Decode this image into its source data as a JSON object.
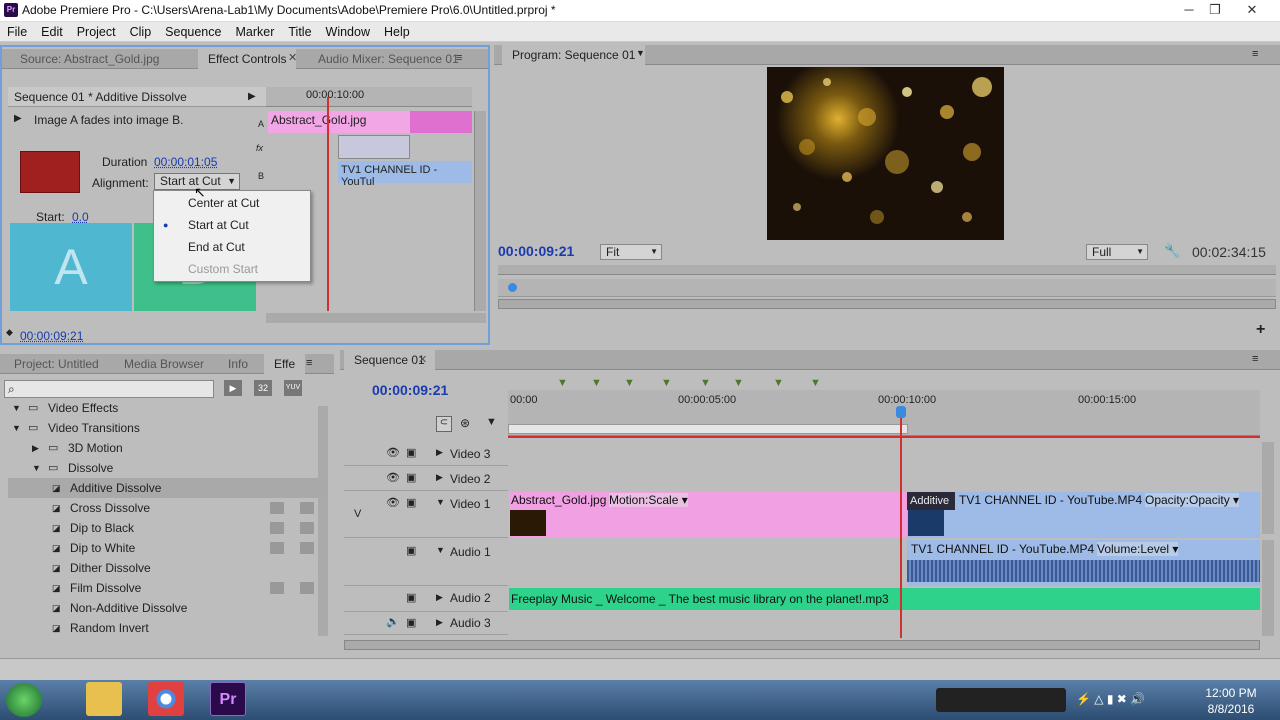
{
  "window": {
    "title": "Adobe Premiere Pro - C:\\Users\\Arena-Lab1\\My Documents\\Adobe\\Premiere Pro\\6.0\\Untitled.prproj *",
    "min": "─",
    "max": "❐",
    "close": "✕"
  },
  "menu": [
    "File",
    "Edit",
    "Project",
    "Clip",
    "Sequence",
    "Marker",
    "Title",
    "Window",
    "Help"
  ],
  "source_panel": {
    "tabs": [
      "Source: Abstract_Gold.jpg",
      "Effect Controls",
      "Audio Mixer: Sequence 01"
    ],
    "header": "Sequence 01 * Additive Dissolve",
    "description": "Image A fades into image B.",
    "duration_label": "Duration",
    "duration_value": "00:00:01:05",
    "alignment_label": "Alignment:",
    "alignment_value": "Start at Cut",
    "start_label": "Start:",
    "start_value": "0.0",
    "preview_a": "A",
    "preview_b": "B",
    "ruler_time": "00:00:10:00",
    "clip_a": "Abstract_Gold.jpg",
    "clip_b": "TV1 CHANNEL ID - YouTul",
    "track_a": "A",
    "track_fx": "fx",
    "track_b": "B",
    "footer_time": "00:00:09:21",
    "dropdown": [
      "Center at Cut",
      "Start at Cut",
      "End at Cut",
      "Custom Start"
    ]
  },
  "program_panel": {
    "title": "Program: Sequence 01",
    "timecode": "00:00:09:21",
    "fit": "Fit",
    "quality": "Full",
    "duration": "00:02:34:15",
    "add": "+"
  },
  "project_panel": {
    "tabs": [
      "Project: Untitled",
      "Media Browser",
      "Info",
      "Effe"
    ],
    "tree": [
      {
        "label": "Video Effects",
        "depth": 0
      },
      {
        "label": "Video Transitions",
        "depth": 0
      },
      {
        "label": "3D Motion",
        "depth": 1
      },
      {
        "label": "Dissolve",
        "depth": 1
      },
      {
        "label": "Additive Dissolve",
        "depth": 2,
        "sel": true
      },
      {
        "label": "Cross Dissolve",
        "depth": 2,
        "badge": true
      },
      {
        "label": "Dip to Black",
        "depth": 2,
        "badge": true
      },
      {
        "label": "Dip to White",
        "depth": 2,
        "badge": true
      },
      {
        "label": "Dither Dissolve",
        "depth": 2
      },
      {
        "label": "Film Dissolve",
        "depth": 2,
        "badge": true
      },
      {
        "label": "Non-Additive Dissolve",
        "depth": 2
      },
      {
        "label": "Random Invert",
        "depth": 2
      }
    ],
    "badge32": "32",
    "badgeyuv": "YUV"
  },
  "timeline": {
    "tab": "Sequence 01",
    "timecode": "00:00:09:21",
    "ruler": [
      "00:00",
      "00:00:05:00",
      "00:00:10:00",
      "00:00:15:00"
    ],
    "tracks": [
      "Video 3",
      "Video 2",
      "Video 1",
      "Audio 1",
      "Audio 2",
      "Audio 3"
    ],
    "v_label": "V",
    "clip_v1a": "Abstract_Gold.jpg",
    "clip_v1a_fx": "Motion:Scale ▾",
    "clip_trans": "Additive",
    "clip_v1b": "TV1 CHANNEL ID - YouTube.MP4 [V]",
    "clip_v1b_fx": "Opacity:Opacity ▾",
    "clip_a1": "TV1 CHANNEL ID - YouTube.MP4 [A]",
    "clip_a1_fx": "Volume:Level ▾",
    "clip_a2": "Freeplay Music _ Welcome _ The best music library on the planet!.mp3"
  },
  "taskbar": {
    "time": "12:00 PM",
    "date": "8/8/2016"
  },
  "colors": {
    "pink": "#f1a0e4",
    "blue": "#9dbbe6",
    "green": "#2dd38a",
    "playhead": "#d03030",
    "timecode": "#1a3ab0"
  }
}
